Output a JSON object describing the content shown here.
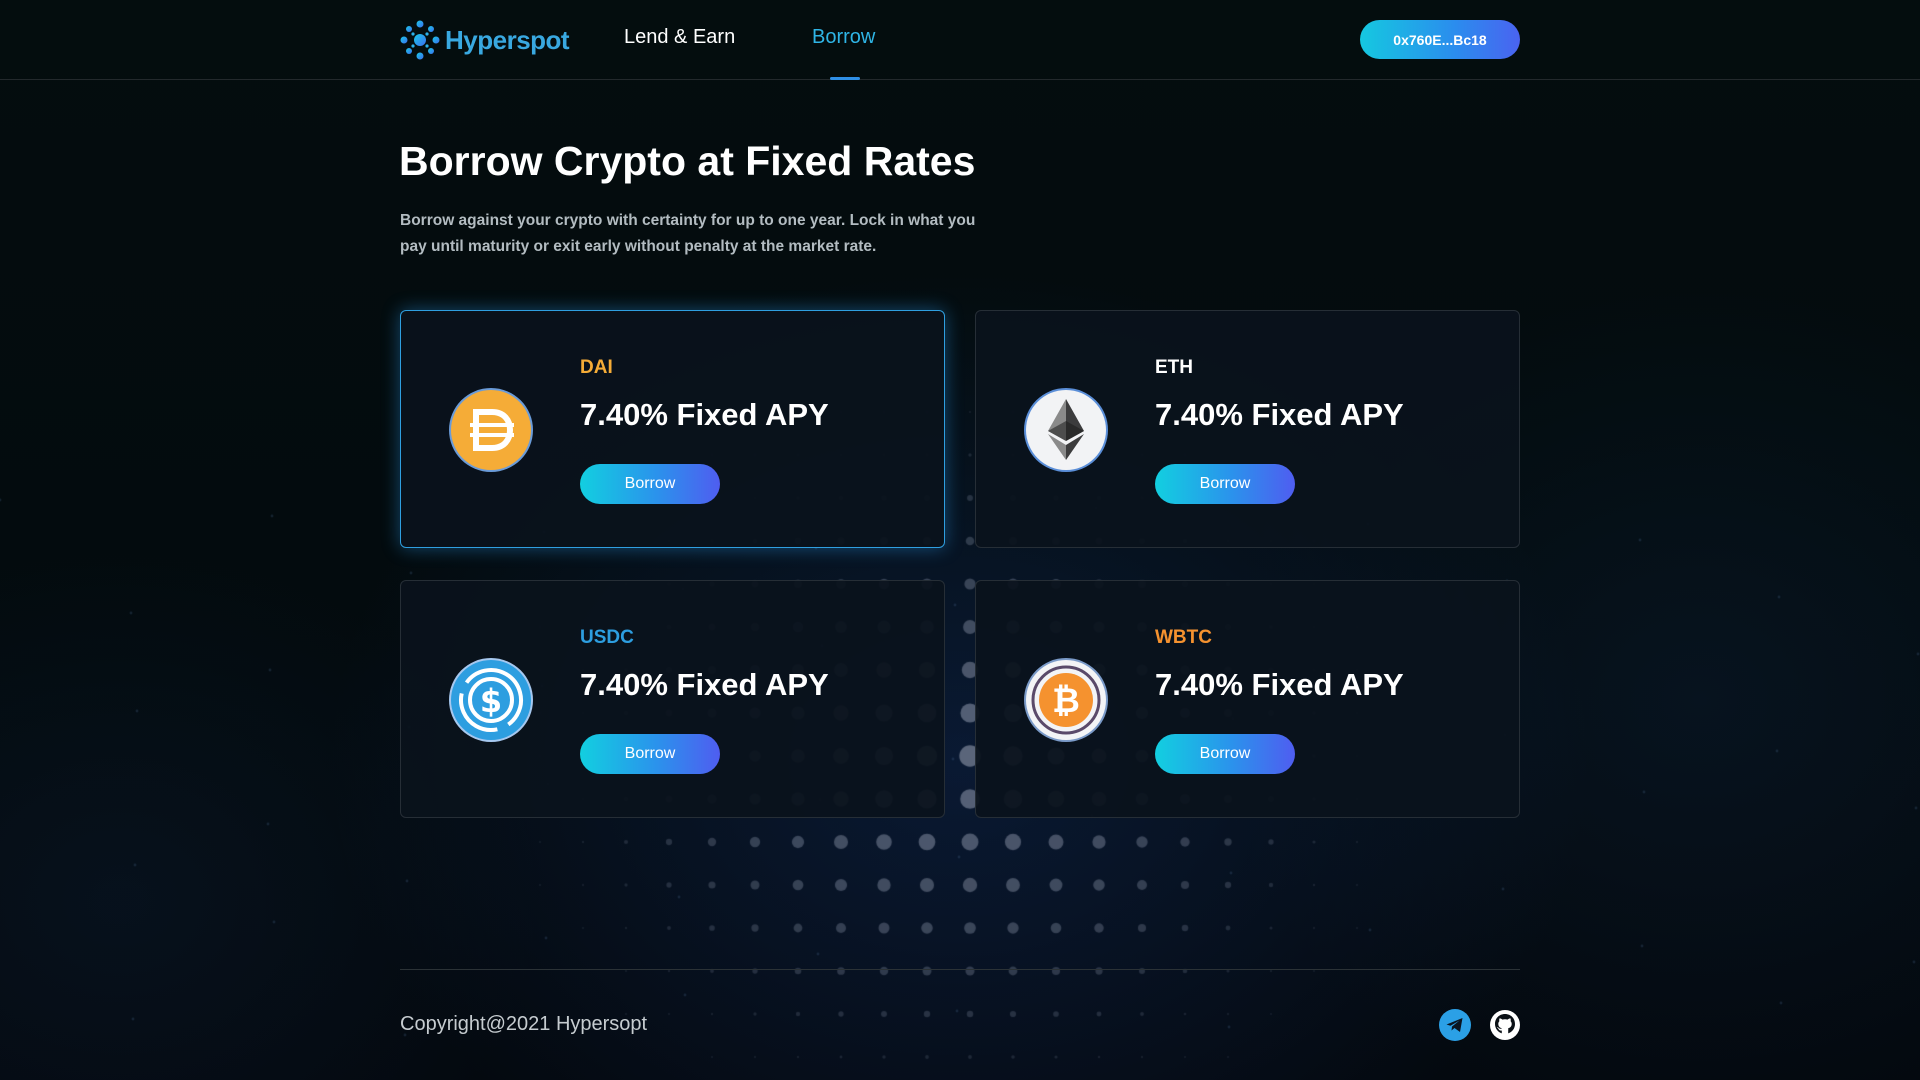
{
  "header": {
    "logo_text": "Hyperspot",
    "nav": [
      {
        "label": "Lend & Earn",
        "active": false
      },
      {
        "label": "Borrow",
        "active": true
      }
    ],
    "wallet_address": "0x760E...Bc18"
  },
  "hero": {
    "title": "Borrow Crypto at Fixed Rates",
    "description": "Borrow against your crypto with certainty for up to one year. Lock in what you pay until maturity or exit early without penalty at the market rate."
  },
  "cards": [
    {
      "symbol": "DAI",
      "symbol_color": "#f5ac37",
      "apy": "7.40% Fixed APY",
      "button": "Borrow",
      "icon": "dai-icon",
      "selected": true
    },
    {
      "symbol": "ETH",
      "symbol_color": "#ffffff",
      "apy": "7.40% Fixed APY",
      "button": "Borrow",
      "icon": "eth-icon",
      "selected": false
    },
    {
      "symbol": "USDC",
      "symbol_color": "#2d9ee0",
      "apy": "7.40% Fixed APY",
      "button": "Borrow",
      "icon": "usdc-icon",
      "selected": false
    },
    {
      "symbol": "WBTC",
      "symbol_color": "#f5922f",
      "apy": "7.40% Fixed APY",
      "button": "Borrow",
      "icon": "wbtc-icon",
      "selected": false
    }
  ],
  "footer": {
    "copyright": "Copyright@2021 Hypersopt",
    "social": [
      "telegram-icon",
      "github-icon"
    ]
  },
  "colors": {
    "accent": "#2fb5e6",
    "gradient_start": "#12cfe0",
    "gradient_end": "#4f5df0",
    "background": "#030a0c"
  }
}
